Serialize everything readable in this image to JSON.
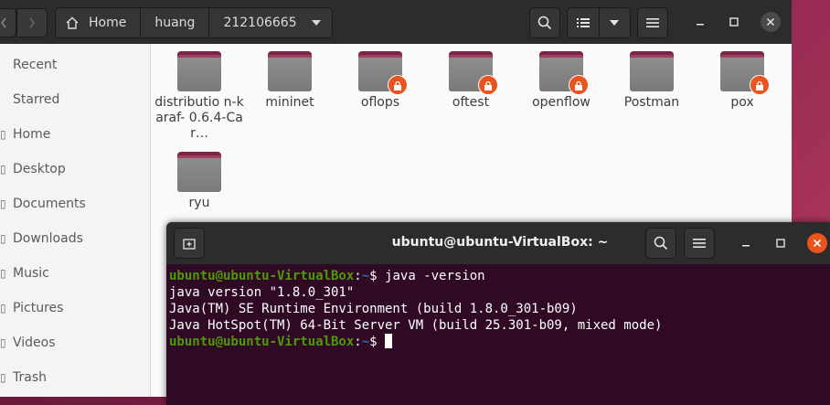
{
  "files": {
    "breadcrumbs": [
      {
        "label": "Home",
        "icon": "home-icon"
      },
      {
        "label": "huang"
      },
      {
        "label": "212106665"
      }
    ],
    "sidebar": [
      {
        "label": "Recent",
        "icon": "clock-icon"
      },
      {
        "label": "Starred",
        "icon": "star-icon"
      },
      {
        "label": "Home",
        "icon": "home-icon"
      },
      {
        "label": "Desktop",
        "icon": "desktop-icon"
      },
      {
        "label": "Documents",
        "icon": "document-icon"
      },
      {
        "label": "Downloads",
        "icon": "download-icon"
      },
      {
        "label": "Music",
        "icon": "music-icon"
      },
      {
        "label": "Pictures",
        "icon": "picture-icon"
      },
      {
        "label": "Videos",
        "icon": "video-icon"
      },
      {
        "label": "Trash",
        "icon": "trash-icon"
      }
    ],
    "folders": [
      {
        "name": "distributio n-karaf- 0.6.4-Car…",
        "locked": false
      },
      {
        "name": "mininet",
        "locked": false
      },
      {
        "name": "oflops",
        "locked": true
      },
      {
        "name": "oftest",
        "locked": true
      },
      {
        "name": "openflow",
        "locked": true
      },
      {
        "name": "Postman",
        "locked": false
      },
      {
        "name": "pox",
        "locked": true
      },
      {
        "name": "ryu",
        "locked": false
      }
    ]
  },
  "terminal": {
    "title": "ubuntu@ubuntu-VirtualBox: ~",
    "prompt_user": "ubuntu@ubuntu-VirtualBox",
    "prompt_sep": ":",
    "prompt_path": "~",
    "prompt_dollar": "$ ",
    "command": "java -version",
    "output": [
      "java version \"1.8.0_301\"",
      "Java(TM) SE Runtime Environment (build 1.8.0_301-b09)",
      "Java HotSpot(TM) 64-Bit Server VM (build 25.301-b09, mixed mode)"
    ]
  },
  "colors": {
    "accent": "#e95420",
    "terminal_bg": "#300a24",
    "prompt_user": "#4e9a06",
    "prompt_path": "#3465a4"
  }
}
